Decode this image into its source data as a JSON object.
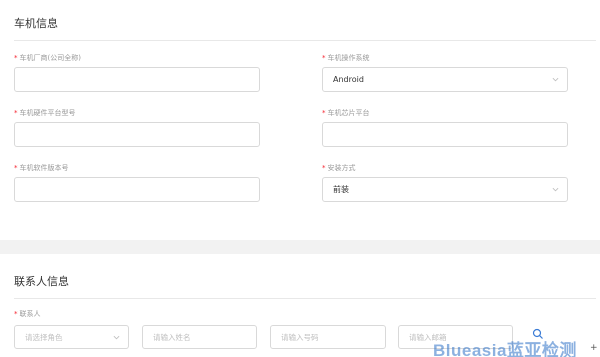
{
  "vehicle_section": {
    "title": "车机信息",
    "fields": {
      "manufacturer": {
        "label": "车机厂商(公司全称)",
        "value": ""
      },
      "os": {
        "label": "车机操作系统",
        "value": "Android"
      },
      "hardware_model": {
        "label": "车机硬件平台型号",
        "value": ""
      },
      "chip_platform": {
        "label": "车机芯片平台",
        "value": ""
      },
      "software_version": {
        "label": "车机软件版本号",
        "value": ""
      },
      "install_method": {
        "label": "安装方式",
        "value": "前装"
      }
    },
    "required_mark": "*"
  },
  "contact_section": {
    "title": "联系人信息",
    "contact_label": "联系人",
    "required_mark": "*",
    "role_placeholder": "请选择角色",
    "name_placeholder": "请输入姓名",
    "account_placeholder": "请输入号码",
    "email_placeholder": "请输入邮箱"
  },
  "watermark": "Blueasia蓝亚检测",
  "corner_mark": "+"
}
